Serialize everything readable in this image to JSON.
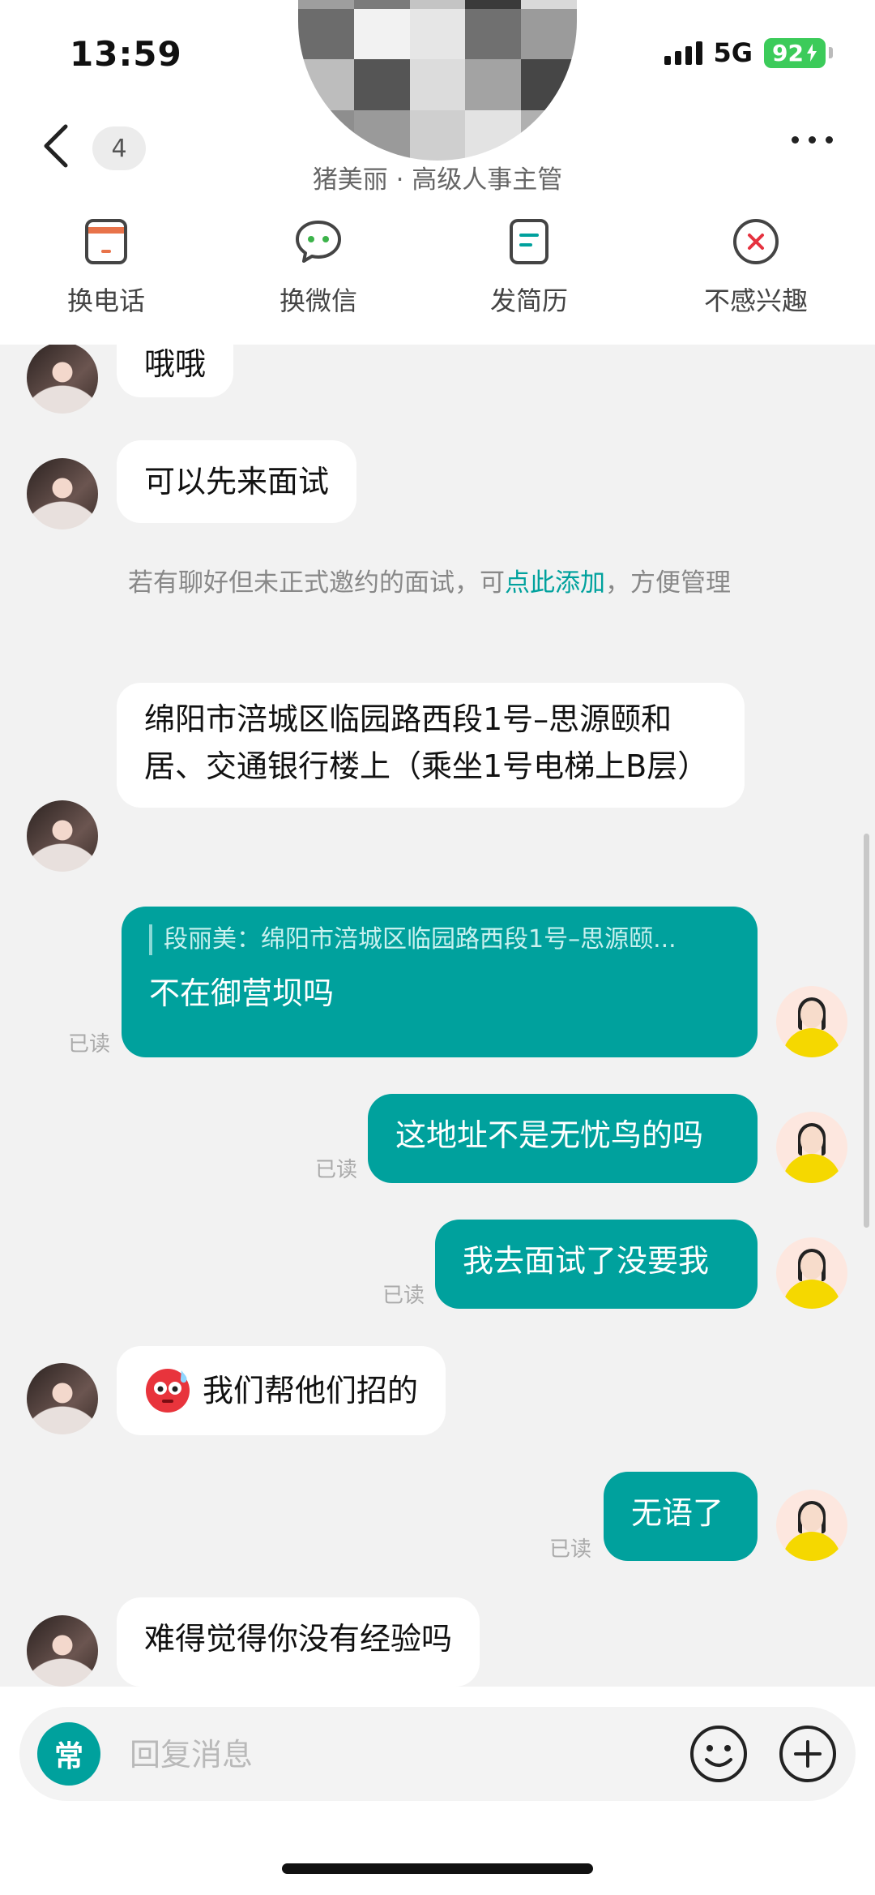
{
  "status_bar": {
    "time": "13:59",
    "network": "5G",
    "battery": "92"
  },
  "header": {
    "unread_count": "4",
    "contact_subtitle": "猪美丽 · 高级人事主管"
  },
  "actions": [
    {
      "label": "换电话",
      "icon": "phone-card-icon"
    },
    {
      "label": "换微信",
      "icon": "wechat-icon"
    },
    {
      "label": "发简历",
      "icon": "resume-icon"
    },
    {
      "label": "不感兴趣",
      "icon": "not-interested-icon"
    }
  ],
  "messages": {
    "m1": "哦哦",
    "m2": "可以先来面试",
    "m3": "绵阳市涪城区临园路西段1号–思源颐和居、交通银行楼上（乘坐1号电梯上B层）",
    "m4_quote": "段丽美：绵阳市涪城区临园路西段1号–思源颐...",
    "m4": "不在御营坝吗",
    "m5": "这地址不是无忧鸟的吗",
    "m6": "我去面试了没要我",
    "m7": "我们帮他们招的",
    "m8": "无语了",
    "m9": "难得觉得你没有经验吗",
    "read_label": "已读"
  },
  "system_note": {
    "prefix": "若有聊好但未正式邀约的面试，可",
    "link": "点此添加",
    "suffix": "，方便管理"
  },
  "input": {
    "placeholder": "回复消息",
    "quick_label": "常"
  },
  "colors": {
    "accent": "#00a19d",
    "battery": "#3ccb5a"
  }
}
